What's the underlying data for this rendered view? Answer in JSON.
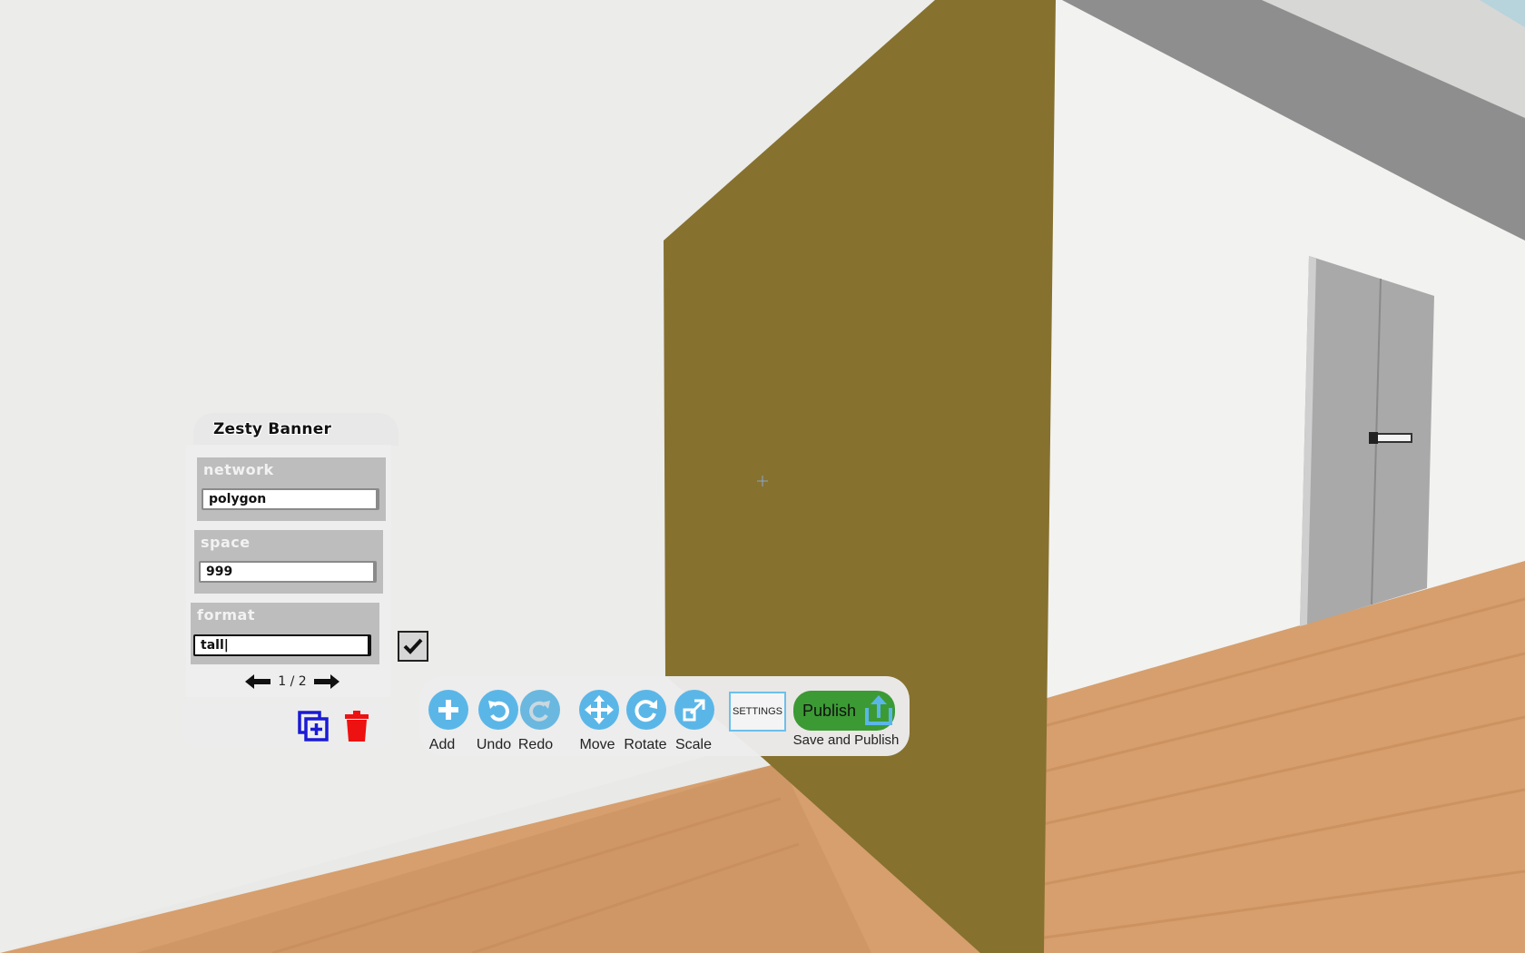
{
  "scene": {
    "wall_color": "#eaeae8",
    "banner_color": "#86712f",
    "floor_color": "#d8a070",
    "door_color": "#a9a9a9"
  },
  "panel": {
    "title": "Zesty Banner",
    "fields": [
      {
        "label": "network",
        "value": "polygon"
      },
      {
        "label": "space",
        "value": "999"
      },
      {
        "label": "format",
        "value": "tall|"
      }
    ],
    "pager_text": "1 / 2",
    "confirm_icon": "checkmark-icon",
    "duplicate_icon": "duplicate-icon",
    "delete_icon": "trash-icon"
  },
  "toolbar": {
    "add": "Add",
    "undo": "Undo",
    "redo": "Redo",
    "move": "Move",
    "rotate": "Rotate",
    "scale": "Scale",
    "settings": "SETTINGS",
    "publish": "Publish",
    "publish_sub": "Save and Publish",
    "accent": "#5bb6e8",
    "publish_color": "#3c9a34"
  }
}
